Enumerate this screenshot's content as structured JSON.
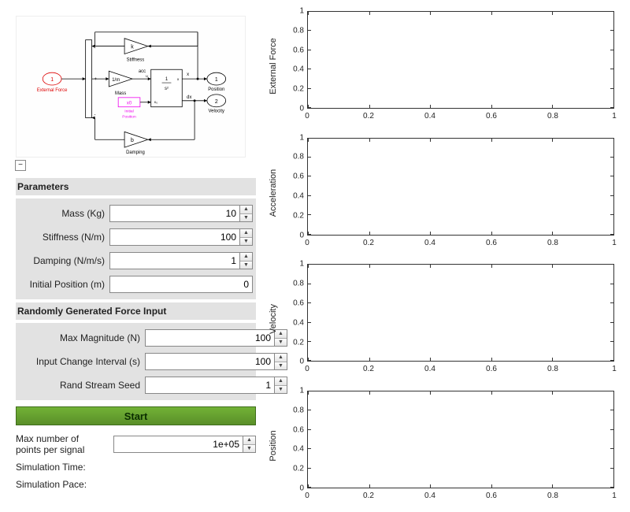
{
  "diagram": {
    "stiffness_gain": "k",
    "stiffness_label": "Stiffness",
    "mass_gain": "1/m",
    "mass_label": "Mass",
    "acc_label": "acc",
    "input_port": "1",
    "input_label": "External Force",
    "initial_pos_box": "x0",
    "initial_pos_label": "Initial\nPosition",
    "integrator_top": "1\ns",
    "integrator_bottom": "1\ns",
    "x_label": "x",
    "dx_label": "dx",
    "out1_port": "1",
    "out1_label": "Position",
    "out2_port": "2",
    "out2_label": "Velocity",
    "damping_gain": "b",
    "damping_label": "Damping",
    "u_label": "u",
    "x0_port": "x",
    "x0o_port": "x₀"
  },
  "collapse_icon": "−",
  "parameters": {
    "header": "Parameters",
    "mass": {
      "label": "Mass (Kg)",
      "value": "10"
    },
    "stiffness": {
      "label": "Stiffness (N/m)",
      "value": "100"
    },
    "damping": {
      "label": "Damping (N/m/s)",
      "value": "1"
    },
    "initial_position": {
      "label": "Initial Position (m)",
      "value": "0"
    }
  },
  "force": {
    "header": "Randomly Generated Force Input",
    "max_magnitude": {
      "label": "Max Magnitude (N)",
      "value": "100"
    },
    "interval": {
      "label": "Input Change Interval (s)",
      "value": "100"
    },
    "seed": {
      "label": "Rand Stream Seed",
      "value": "1"
    }
  },
  "start_label": "Start",
  "max_points": {
    "label": "Max number of points per signal",
    "value": "1e+05"
  },
  "sim_time_label": "Simulation Time:",
  "sim_pace_label": "Simulation Pace:",
  "chart_data": [
    {
      "type": "line",
      "ylabel": "External Force",
      "yticks": [
        "0",
        "0.2",
        "0.4",
        "0.6",
        "0.8",
        "1"
      ],
      "xticks": [
        "0",
        "0.2",
        "0.4",
        "0.6",
        "0.8",
        "1"
      ],
      "series": []
    },
    {
      "type": "line",
      "ylabel": "Acceleration",
      "yticks": [
        "0",
        "0.2",
        "0.4",
        "0.6",
        "0.8",
        "1"
      ],
      "xticks": [
        "0",
        "0.2",
        "0.4",
        "0.6",
        "0.8",
        "1"
      ],
      "series": []
    },
    {
      "type": "line",
      "ylabel": "Velocity",
      "yticks": [
        "0",
        "0.2",
        "0.4",
        "0.6",
        "0.8",
        "1"
      ],
      "xticks": [
        "0",
        "0.2",
        "0.4",
        "0.6",
        "0.8",
        "1"
      ],
      "series": []
    },
    {
      "type": "line",
      "ylabel": "Position",
      "yticks": [
        "0",
        "0.2",
        "0.4",
        "0.6",
        "0.8",
        "1"
      ],
      "xticks": [
        "0",
        "0.2",
        "0.4",
        "0.6",
        "0.8",
        "1"
      ],
      "series": []
    }
  ]
}
